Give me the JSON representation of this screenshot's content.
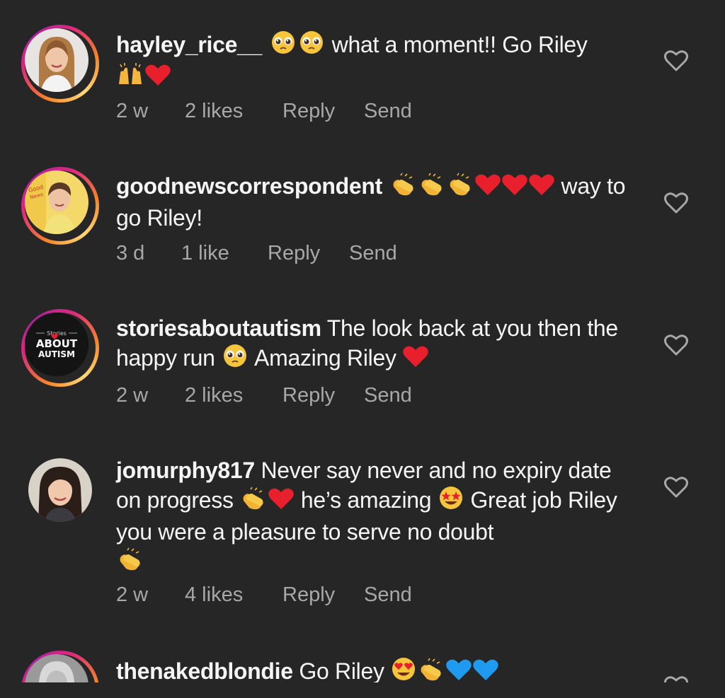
{
  "comments": [
    {
      "username": "hayley_rice__",
      "segments": [
        {
          "type": "emoji",
          "icon": "pleading-face"
        },
        {
          "type": "emoji",
          "icon": "pleading-face"
        },
        {
          "type": "text",
          "text": " what a moment!! Go Riley "
        },
        {
          "type": "emoji",
          "icon": "raising-hands"
        },
        {
          "type": "emoji",
          "icon": "red-heart"
        }
      ],
      "time": "2 w",
      "likes": "2 likes",
      "reply": "Reply",
      "send": "Send",
      "ring": true,
      "avatar": "woman-blonde"
    },
    {
      "username": "goodnewscorrespondent",
      "segments": [
        {
          "type": "emoji",
          "icon": "clapping-hands"
        },
        {
          "type": "emoji",
          "icon": "clapping-hands"
        },
        {
          "type": "emoji",
          "icon": "clapping-hands"
        },
        {
          "type": "emoji",
          "icon": "red-heart"
        },
        {
          "type": "emoji",
          "icon": "red-heart"
        },
        {
          "type": "emoji",
          "icon": "red-heart"
        },
        {
          "type": "text",
          "text": " way to go Riley!"
        }
      ],
      "time": "3 d",
      "likes": "1 like",
      "reply": "Reply",
      "send": "Send",
      "ring": true,
      "avatar": "young-man"
    },
    {
      "username": "storiesaboutautism",
      "segments": [
        {
          "type": "text",
          "text": " The look back at you then the happy run "
        },
        {
          "type": "emoji",
          "icon": "pleading-face"
        },
        {
          "type": "text",
          "text": " Amazing Riley "
        },
        {
          "type": "emoji",
          "icon": "red-heart"
        }
      ],
      "time": "2 w",
      "likes": "2 likes",
      "reply": "Reply",
      "send": "Send",
      "ring": true,
      "avatar": "stories-about-autism-logo",
      "avatar_text": {
        "top": "Stories",
        "mid": "ABOUT",
        "bottom": "AUTISM"
      }
    },
    {
      "username": "jomurphy817",
      "segments": [
        {
          "type": "text",
          "text": " Never say never and no expiry date on progress "
        },
        {
          "type": "emoji",
          "icon": "clapping-hands"
        },
        {
          "type": "emoji",
          "icon": "red-heart"
        },
        {
          "type": "text",
          "text": " he’s amazing "
        },
        {
          "type": "emoji",
          "icon": "star-struck"
        },
        {
          "type": "text",
          "text": " Great job Riley you were a pleasure to serve no doubt "
        },
        {
          "type": "emoji",
          "icon": "clapping-hands"
        }
      ],
      "time": "2 w",
      "likes": "4 likes",
      "reply": "Reply",
      "send": "Send",
      "ring": false,
      "avatar": "woman-dark-hair"
    },
    {
      "username": "thenakedblondie",
      "segments": [
        {
          "type": "text",
          "text": " Go Riley "
        },
        {
          "type": "emoji",
          "icon": "heart-eyes"
        },
        {
          "type": "emoji",
          "icon": "clapping-hands"
        },
        {
          "type": "emoji",
          "icon": "blue-heart"
        },
        {
          "type": "emoji",
          "icon": "blue-heart"
        }
      ],
      "time": "",
      "likes": "",
      "reply": "",
      "send": "",
      "ring": true,
      "avatar": "woman-partial"
    }
  ],
  "colors": {
    "background": "#262626",
    "text": "#f5f5f5",
    "meta": "#a8a8a8",
    "ring_start": "#f58529",
    "ring_mid": "#dd2a7b",
    "ring_end": "#b11fa1",
    "heart_icon": "#a8a8a8"
  }
}
